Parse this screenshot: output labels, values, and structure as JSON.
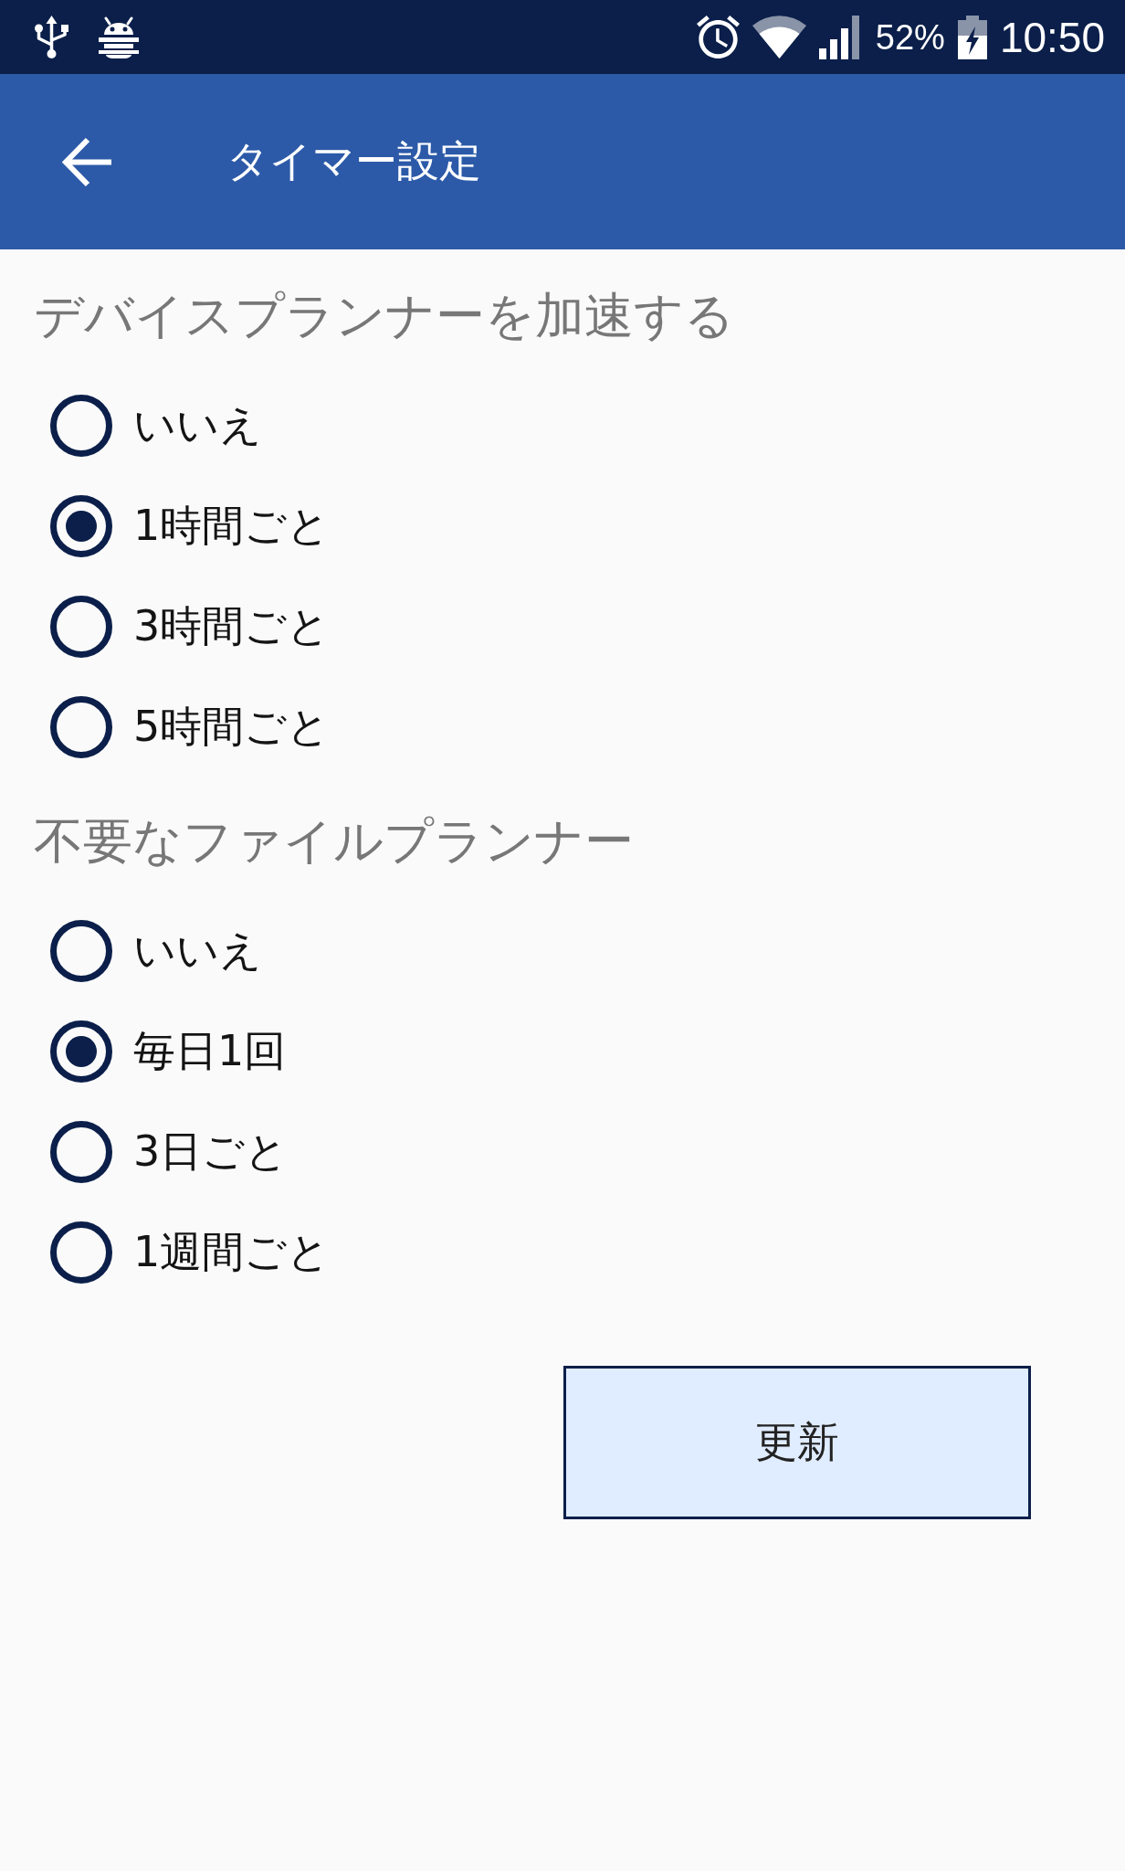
{
  "status_bar": {
    "battery_percent": "52%",
    "time": "10:50"
  },
  "app_bar": {
    "title": "タイマー設定"
  },
  "sections": [
    {
      "heading": "デバイスプランナーを加速する",
      "options": [
        {
          "label": "いいえ",
          "selected": false
        },
        {
          "label": "1時間ごと",
          "selected": true
        },
        {
          "label": "3時間ごと",
          "selected": false
        },
        {
          "label": "5時間ごと",
          "selected": false
        }
      ]
    },
    {
      "heading": "不要なファイルプランナー",
      "options": [
        {
          "label": "いいえ",
          "selected": false
        },
        {
          "label": "毎日1回",
          "selected": true
        },
        {
          "label": "3日ごと",
          "selected": false
        },
        {
          "label": "1週間ごと",
          "selected": false
        }
      ]
    }
  ],
  "update_button": {
    "label": "更新"
  }
}
